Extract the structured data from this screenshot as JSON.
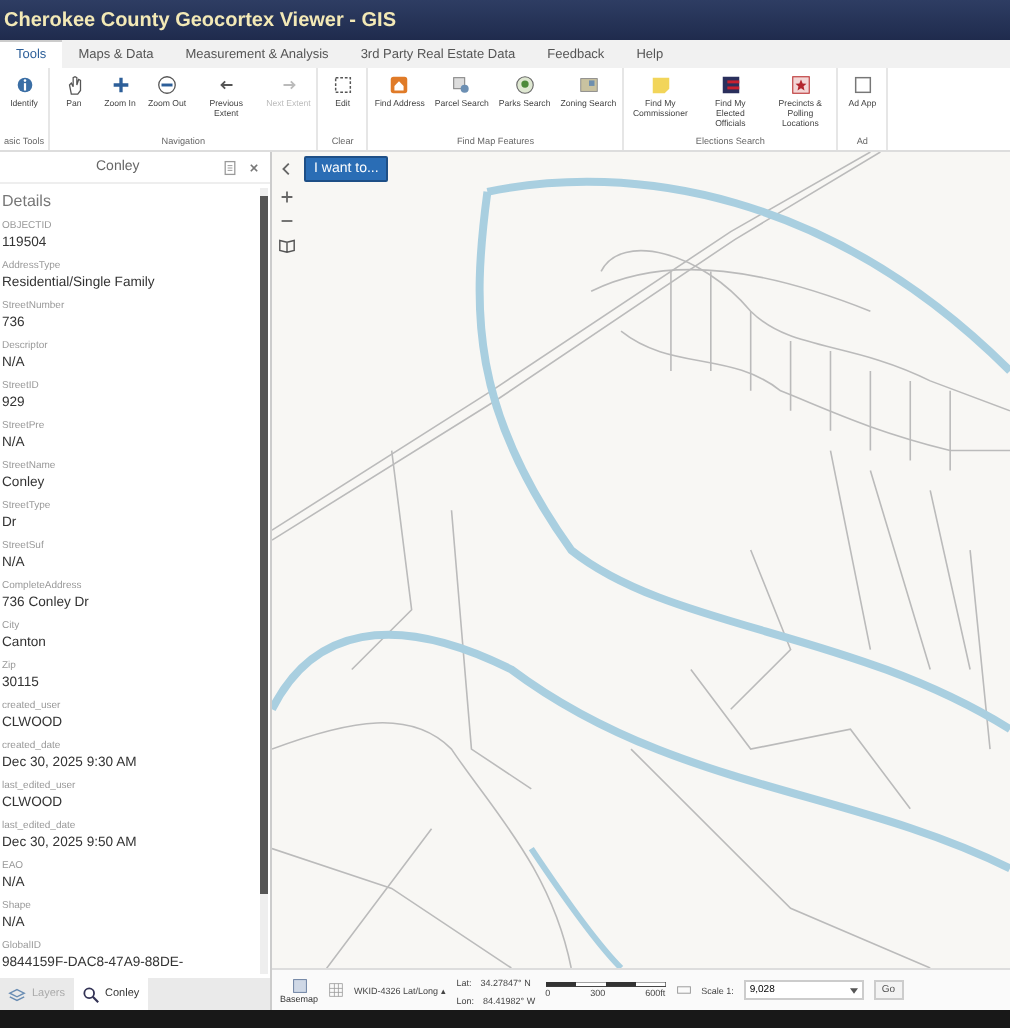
{
  "window": {
    "title": "Cherokee County Geocortex Viewer - GIS"
  },
  "tabs": [
    {
      "label": "Tools",
      "selected": true
    },
    {
      "label": "Maps & Data",
      "selected": false
    },
    {
      "label": "Measurement & Analysis",
      "selected": false
    },
    {
      "label": "3rd Party Real Estate Data",
      "selected": false
    },
    {
      "label": "Feedback",
      "selected": false
    },
    {
      "label": "Help",
      "selected": false
    }
  ],
  "ribbon": [
    {
      "label": "asic Tools",
      "items": [
        {
          "label": "Identify",
          "kind": "identify",
          "disabled": false
        }
      ]
    },
    {
      "label": "Navigation",
      "items": [
        {
          "label": "Pan",
          "kind": "pan",
          "disabled": false
        },
        {
          "label": "Zoom In",
          "kind": "zoomin",
          "disabled": false
        },
        {
          "label": "Zoom Out",
          "kind": "zoomout",
          "disabled": false
        },
        {
          "label": "Previous Extent",
          "kind": "prev",
          "disabled": false
        },
        {
          "label": "Next Extent",
          "kind": "next",
          "disabled": true
        }
      ]
    },
    {
      "label": "Clear",
      "items": [
        {
          "label": "Edit",
          "kind": "edit",
          "disabled": false
        }
      ]
    },
    {
      "label": "Find Map Features",
      "items": [
        {
          "label": "Find Address",
          "kind": "address",
          "disabled": false
        },
        {
          "label": "Parcel Search",
          "kind": "parcel",
          "disabled": false
        },
        {
          "label": "Parks Search",
          "kind": "parks",
          "disabled": false
        },
        {
          "label": "Zoning Search",
          "kind": "zoning",
          "disabled": false
        }
      ]
    },
    {
      "label": "Elections Search",
      "items": [
        {
          "label": "Find My Commissioner",
          "kind": "commissioner",
          "disabled": false
        },
        {
          "label": "Find My Elected Officials",
          "kind": "officials",
          "disabled": false
        },
        {
          "label": "Precincts & Polling Locations",
          "kind": "precincts",
          "disabled": false
        }
      ]
    },
    {
      "label": "Ad",
      "items": [
        {
          "label": "Ad App",
          "kind": "app",
          "disabled": false
        }
      ]
    }
  ],
  "panel": {
    "title": "Conley",
    "heading": "Details",
    "fields": [
      {
        "label": "OBJECTID",
        "value": "119504"
      },
      {
        "label": "AddressType",
        "value": "Residential/Single Family"
      },
      {
        "label": "StreetNumber",
        "value": "736"
      },
      {
        "label": "Descriptor",
        "value": "N/A"
      },
      {
        "label": "StreetID",
        "value": "929"
      },
      {
        "label": "StreetPre",
        "value": "N/A"
      },
      {
        "label": "StreetName",
        "value": "Conley"
      },
      {
        "label": "StreetType",
        "value": "Dr"
      },
      {
        "label": "StreetSuf",
        "value": "N/A"
      },
      {
        "label": "CompleteAddress",
        "value": "736 Conley Dr"
      },
      {
        "label": "City",
        "value": "Canton"
      },
      {
        "label": "Zip",
        "value": "30115"
      },
      {
        "label": "created_user",
        "value": "CLWOOD"
      },
      {
        "label": "created_date",
        "value": "Dec 30, 2025 9:30 AM"
      },
      {
        "label": "last_edited_user",
        "value": "CLWOOD"
      },
      {
        "label": "last_edited_date",
        "value": "Dec 30, 2025 9:50 AM"
      },
      {
        "label": "EAO",
        "value": "N/A"
      },
      {
        "label": "Shape",
        "value": "N/A"
      },
      {
        "label": "GlobalID",
        "value": "9844159F-DAC8-47A9-88DE-"
      }
    ],
    "bottom_tabs": [
      {
        "label": "Layers",
        "selected": false
      },
      {
        "label": "Conley",
        "selected": true
      }
    ]
  },
  "map": {
    "menu_button": "I want to...",
    "status_bar": {
      "basemap": "Basemap",
      "projection": "WKID-4326 Lat/Long ▴",
      "lat_label": "Lat:",
      "lat": "34.27847° N",
      "lon_label": "Lon:",
      "lon": "84.41982° W",
      "scale_ticks": [
        "0",
        "300",
        "600ft"
      ],
      "scale_label": "Scale 1:",
      "scale_value": "9,028",
      "go": "Go"
    }
  }
}
